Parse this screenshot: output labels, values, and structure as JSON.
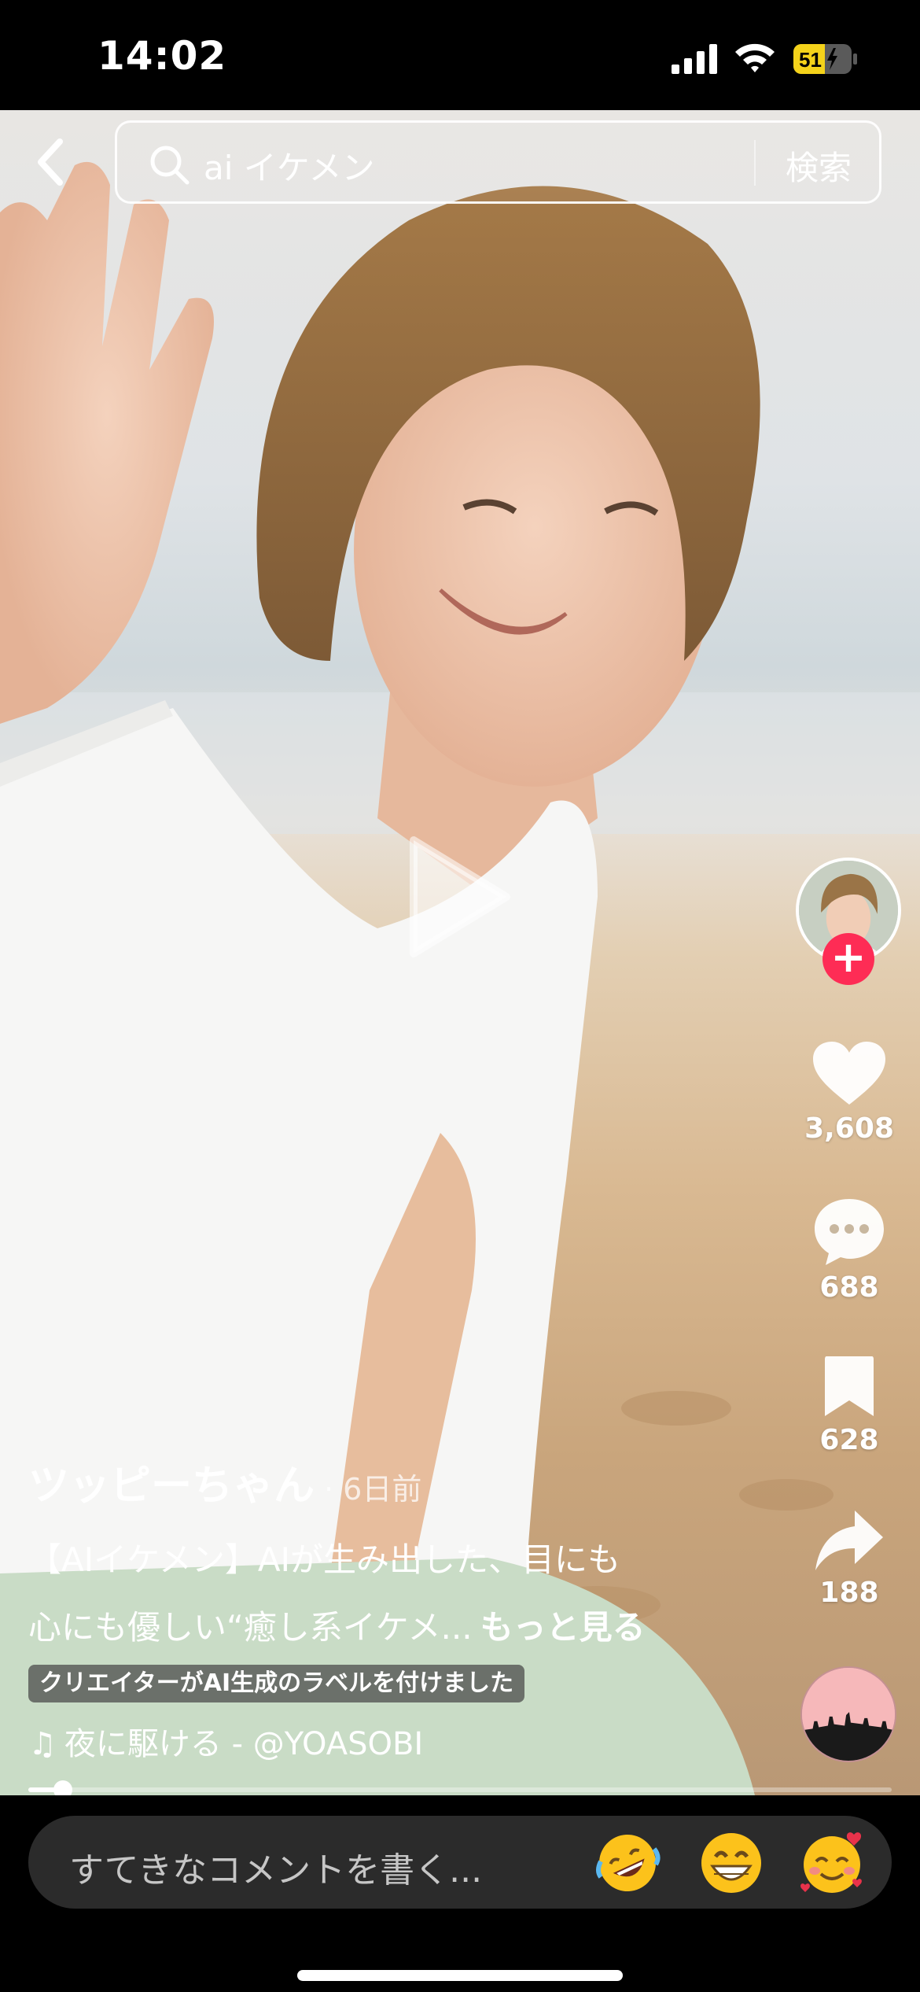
{
  "status_bar": {
    "time": "14:02",
    "battery_level": "51",
    "icons": [
      "signal-icon",
      "wifi-icon",
      "battery-icon"
    ]
  },
  "search": {
    "query": "ai イケメン",
    "button_label": "検索"
  },
  "post": {
    "author": "ツッピーちゃん",
    "time": "· 6日前",
    "caption_line1": "【AIイケメン】AIが生み出した、目にも",
    "caption_line2": "心にも優しい“癒し系イケメ...",
    "see_more": "もっと見る",
    "ai_label": "クリエイターがAI生成のラベルを付けました",
    "music_note": "♫",
    "music": "夜に駆ける - @YOASOBI"
  },
  "actions": {
    "likes": "3,608",
    "comments": "688",
    "saves": "628",
    "shares": "188"
  },
  "progress": {
    "fraction": 0.04
  },
  "comment_bar": {
    "placeholder": "すてきなコメントを書く..."
  },
  "colors": {
    "follow_accent": "#fe2c55",
    "comment_bar_bg": "#2b2b2b",
    "battery_yellow": "#f4d21a"
  }
}
